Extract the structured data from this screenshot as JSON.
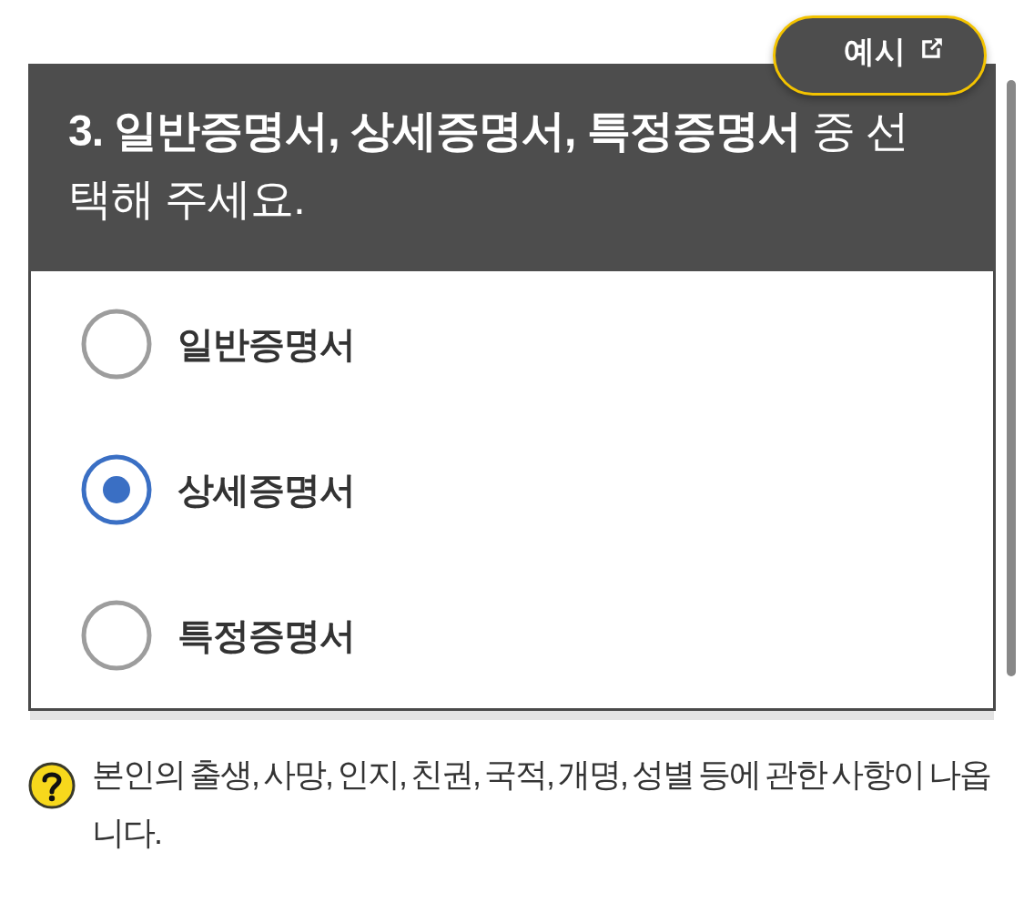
{
  "example_button": {
    "label": "예시"
  },
  "question": {
    "text": "**3. 일반증명서, 상세증명서, 특정증명서** 중 선택해 주세요."
  },
  "options": [
    {
      "label": "일반증명서",
      "selected": false
    },
    {
      "label": "상세증명서",
      "selected": true
    },
    {
      "label": "특정증명서",
      "selected": false
    }
  ],
  "help": {
    "text": "본인의 출생, 사망, 인지, 친권, 국적, 개명, 성별 등에 관한 사항이 나옵니다."
  }
}
